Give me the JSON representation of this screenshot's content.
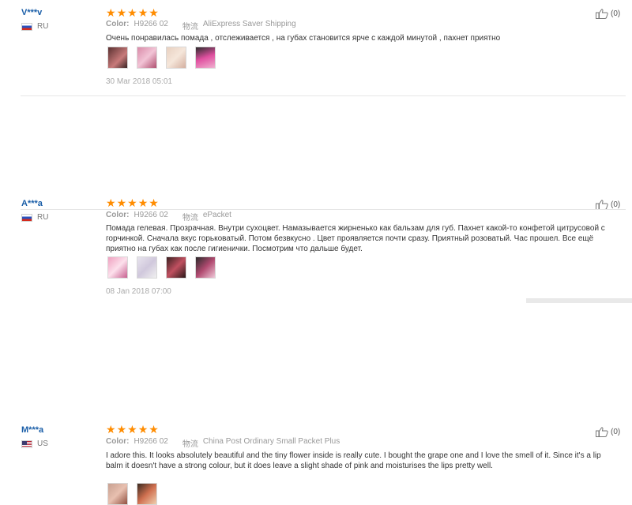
{
  "colors": {
    "star": "#ff8c00",
    "username": "#1a5ea8",
    "muted": "#999999"
  },
  "reviews": [
    {
      "user": "V***v",
      "country": "RU",
      "flag": "russia-flag",
      "rating": 5,
      "color_label": "Color:",
      "color_value": "H9266 02",
      "logistics_label": "物流",
      "shipping": "AliExpress Saver Shipping",
      "text": "Очень понравилась помада , отслеживается , на губах становится ярче с каждой минутой , пахнет приятно",
      "photo_count": 4,
      "date": "30 Mar 2018 05:01",
      "helpful": "(0)"
    },
    {
      "user": "A***a",
      "country": "RU",
      "flag": "russia-flag",
      "rating": 5,
      "color_label": "Color:",
      "color_value": "H9266 02",
      "logistics_label": "物流",
      "shipping": "ePacket",
      "text": "Помада гелевая. Прозрачная. Внутри сухоцвет. Намазывается жирненько как бальзам для губ. Пахнет какой-то конфетой цитрусовой с горчинкой. Сначала вкус горьковатый. Потом безвкусно . Цвет проявляется почти сразу. Приятный розоватый. Час прошел. Все ещё приятно на губах как после гигиенички. Посмотрим что дальше будет.",
      "photo_count": 4,
      "date": "08 Jan 2018 07:00",
      "helpful": "(0)"
    },
    {
      "user": "M***a",
      "country": "US",
      "flag": "usa-flag",
      "rating": 5,
      "color_label": "Color:",
      "color_value": "H9266 02",
      "logistics_label": "物流",
      "shipping": "China Post Ordinary Small Packet Plus",
      "text": "I adore this. It looks absolutely beautiful and the tiny flower inside is really cute. I bought the grape one and I love the smell of it. Since it's a lip balm it doesn't have a strong colour, but it does leave a slight shade of pink and moisturises the lips pretty well.",
      "photo_count": 2,
      "date": "",
      "helpful": "(0)"
    }
  ]
}
